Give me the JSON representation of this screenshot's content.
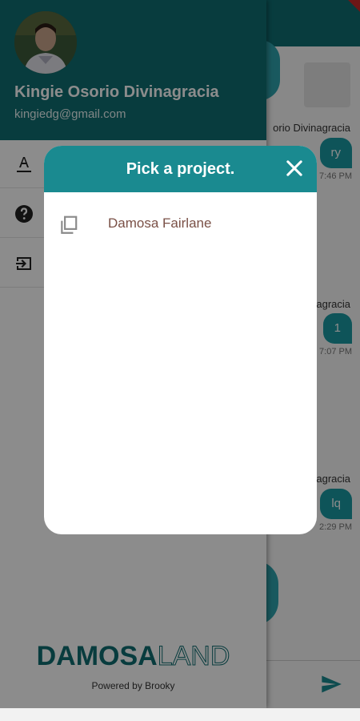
{
  "background": {
    "messages": [
      {
        "sender": "orio Divinagracia",
        "text": "ry",
        "time": "7:46 PM"
      },
      {
        "sender": "agracia",
        "text": "1",
        "time": "7:07 PM"
      },
      {
        "sender": "agracia",
        "text": "lq",
        "time": "2:29 PM"
      }
    ]
  },
  "drawer": {
    "user_name": "Kingie Osorio Divinagracia",
    "user_email": "kingiedg@gmail.com",
    "items": [
      {
        "icon": "font-icon"
      },
      {
        "icon": "help-icon"
      },
      {
        "icon": "logout-icon"
      }
    ],
    "logo_part1": "DAMOSA",
    "logo_part2": "LAND",
    "powered_by": "Powered by Brooky"
  },
  "dialog": {
    "title": "Pick a project.",
    "projects": [
      {
        "label": "Damosa Fairlane",
        "icon": "copy-icon"
      }
    ]
  },
  "colors": {
    "primary": "#0f6e72",
    "dialog_header": "#1a8a90",
    "accent": "#1a9aa3",
    "project_text": "#7a5046"
  }
}
